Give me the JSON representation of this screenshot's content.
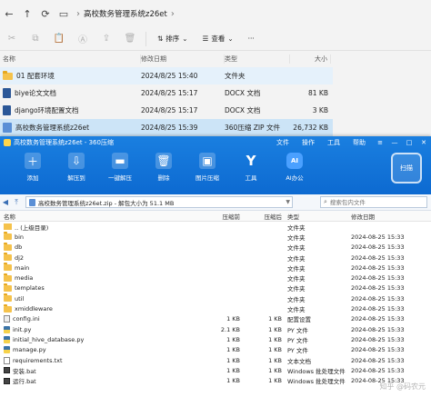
{
  "explorer": {
    "breadcrumb": [
      "高校数务管理系统z26et"
    ],
    "toolbar": {
      "sort_label": "排序",
      "view_label": "查看",
      "more_label": "···"
    },
    "columns": {
      "name": "名称",
      "date": "修改日期",
      "type": "类型",
      "size": "大小"
    },
    "files": [
      {
        "name": "01 配套环境",
        "date": "2024/8/25 15:40",
        "type": "文件夹",
        "size": "",
        "icon": "folder-icon"
      },
      {
        "name": "biye论文文档",
        "date": "2024/8/25 15:17",
        "type": "DOCX 文档",
        "size": "81 KB",
        "icon": "docx-icon"
      },
      {
        "name": "django环境配置文档",
        "date": "2024/8/25 15:17",
        "type": "DOCX 文档",
        "size": "3 KB",
        "icon": "docx-icon"
      },
      {
        "name": "高校数务管理系统z26et",
        "date": "2024/8/25 15:39",
        "type": "360压缩 ZIP 文件",
        "size": "26,732 KB",
        "icon": "zip-icon"
      }
    ]
  },
  "zip_window": {
    "title": "高校数务管理系统z26et - 360压缩",
    "menus": [
      "文件",
      "操作",
      "工具",
      "帮助"
    ],
    "window_controls": [
      "≡",
      "—",
      "□",
      "✕"
    ],
    "tools": [
      {
        "label": "添加",
        "icon": "add-icon"
      },
      {
        "label": "解压到",
        "icon": "extract-to-icon"
      },
      {
        "label": "一键解压",
        "icon": "one-click-extract-icon"
      },
      {
        "label": "删除",
        "icon": "delete-icon"
      },
      {
        "label": "图片压缩",
        "icon": "image-compress-icon"
      },
      {
        "label": "工具",
        "icon": "tools-icon"
      },
      {
        "label": "AI办公",
        "icon": "ai-office-icon"
      }
    ],
    "badge": "扫描",
    "path": "高校数务管理系统z26et.zip - 解包大小为 51.1 MB",
    "search_placeholder": "搜索包内文件",
    "columns": {
      "name": "名称",
      "compressed": "压缩前",
      "original": "压缩后",
      "type": "类型",
      "date": "修改日期"
    },
    "rows": [
      {
        "name": ".. (上级目录)",
        "comp": "",
        "orig": "",
        "type": "文件夹",
        "date": "",
        "icon": "up-dir-icon"
      },
      {
        "name": "bin",
        "comp": "",
        "orig": "",
        "type": "文件夹",
        "date": "2024-08-25 15:33",
        "icon": "folder-icon"
      },
      {
        "name": "db",
        "comp": "",
        "orig": "",
        "type": "文件夹",
        "date": "2024-08-25 15:33",
        "icon": "folder-icon"
      },
      {
        "name": "dj2",
        "comp": "",
        "orig": "",
        "type": "文件夹",
        "date": "2024-08-25 15:33",
        "icon": "folder-icon"
      },
      {
        "name": "main",
        "comp": "",
        "orig": "",
        "type": "文件夹",
        "date": "2024-08-25 15:33",
        "icon": "folder-icon"
      },
      {
        "name": "media",
        "comp": "",
        "orig": "",
        "type": "文件夹",
        "date": "2024-08-25 15:33",
        "icon": "folder-icon"
      },
      {
        "name": "templates",
        "comp": "",
        "orig": "",
        "type": "文件夹",
        "date": "2024-08-25 15:33",
        "icon": "folder-icon"
      },
      {
        "name": "util",
        "comp": "",
        "orig": "",
        "type": "文件夹",
        "date": "2024-08-25 15:33",
        "icon": "folder-icon"
      },
      {
        "name": "xmiddleware",
        "comp": "",
        "orig": "",
        "type": "文件夹",
        "date": "2024-08-25 15:33",
        "icon": "folder-icon"
      },
      {
        "name": "config.ini",
        "comp": "1 KB",
        "orig": "1 KB",
        "type": "配置设置",
        "date": "2024-08-25 15:33",
        "icon": "config-file-icon"
      },
      {
        "name": "init.py",
        "comp": "2.1 KB",
        "orig": "1 KB",
        "type": "PY 文件",
        "date": "2024-08-25 15:33",
        "icon": "python-file-icon"
      },
      {
        "name": "initial_hive_database.py",
        "comp": "1 KB",
        "orig": "1 KB",
        "type": "PY 文件",
        "date": "2024-08-25 15:33",
        "icon": "python-file-icon"
      },
      {
        "name": "manage.py",
        "comp": "1 KB",
        "orig": "1 KB",
        "type": "PY 文件",
        "date": "2024-08-25 15:33",
        "icon": "python-file-icon"
      },
      {
        "name": "requirements.txt",
        "comp": "1 KB",
        "orig": "1 KB",
        "type": "文本文档",
        "date": "2024-08-25 15:33",
        "icon": "text-file-icon"
      },
      {
        "name": "安装.bat",
        "comp": "1 KB",
        "orig": "1 KB",
        "type": "Windows 批处理文件",
        "date": "2024-08-25 15:33",
        "icon": "batch-file-icon"
      },
      {
        "name": "运行.bat",
        "comp": "1 KB",
        "orig": "1 KB",
        "type": "Windows 批处理文件",
        "date": "2024-08-25 15:33",
        "icon": "batch-file-icon"
      }
    ]
  },
  "watermark": "知乎 @码农元"
}
